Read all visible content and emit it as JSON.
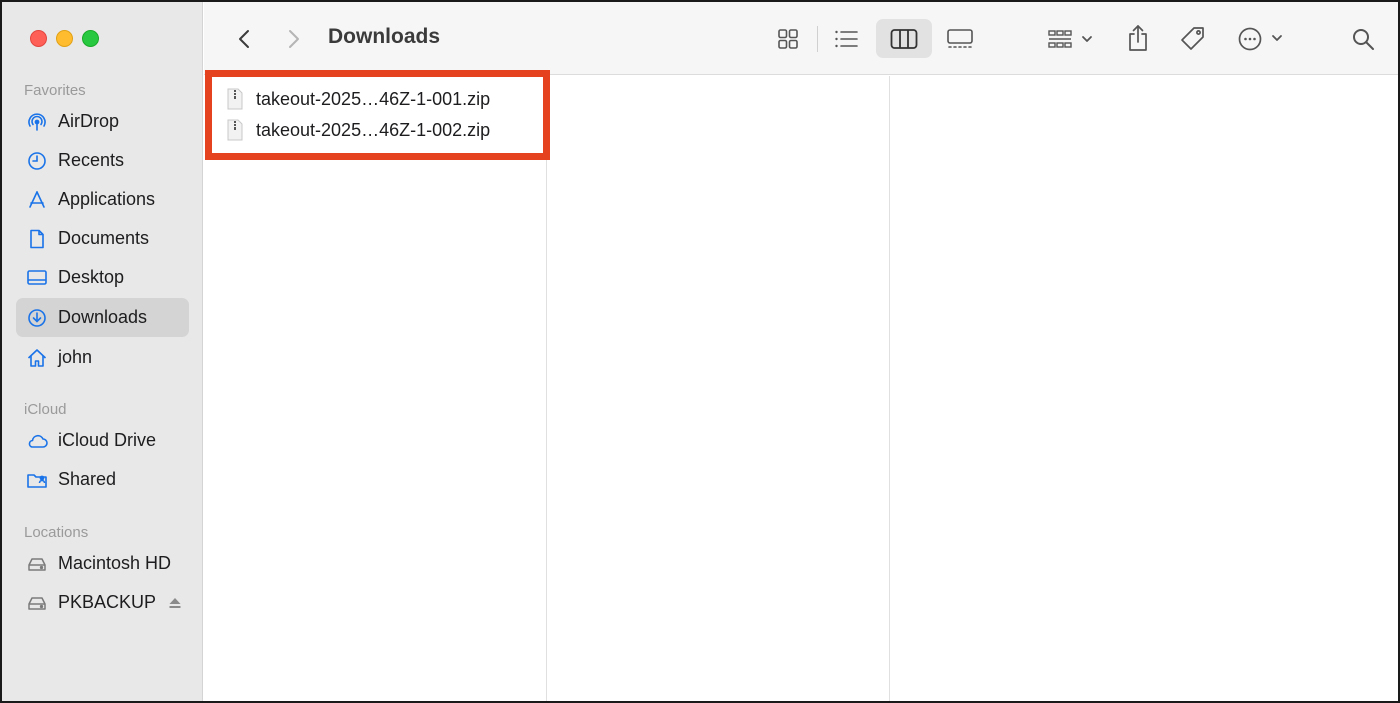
{
  "window": {
    "title": "Downloads"
  },
  "sidebar": {
    "sections": [
      {
        "label": "Favorites"
      },
      {
        "label": "iCloud"
      },
      {
        "label": "Locations"
      }
    ],
    "favorites": [
      {
        "label": "AirDrop",
        "icon": "airdrop-icon"
      },
      {
        "label": "Recents",
        "icon": "clock-icon"
      },
      {
        "label": "Applications",
        "icon": "applications-icon"
      },
      {
        "label": "Documents",
        "icon": "document-icon"
      },
      {
        "label": "Desktop",
        "icon": "desktop-icon"
      },
      {
        "label": "Downloads",
        "icon": "download-icon",
        "selected": true
      },
      {
        "label": "john",
        "icon": "home-icon"
      }
    ],
    "icloud": [
      {
        "label": "iCloud Drive",
        "icon": "cloud-icon"
      },
      {
        "label": "Shared",
        "icon": "shared-folder-icon"
      }
    ],
    "locations": [
      {
        "label": "Macintosh HD",
        "icon": "drive-icon"
      },
      {
        "label": "PKBACKUP",
        "icon": "drive-icon",
        "ejectable": true
      }
    ]
  },
  "toolbar": {
    "buttons": [
      "back-icon",
      "forward-icon",
      "icon-view-icon",
      "list-view-icon",
      "column-view-icon",
      "gallery-view-icon",
      "group-icon",
      "share-icon",
      "tag-icon",
      "more-icon",
      "search-icon"
    ],
    "active_view": "column"
  },
  "files": [
    {
      "name": "takeout-2025…46Z-1-001.zip"
    },
    {
      "name": "takeout-2025…46Z-1-002.zip"
    }
  ],
  "colors": {
    "accent": "#1a73e8",
    "highlight_border": "#e5431f",
    "sidebar_bg": "#e8e8e8",
    "selected_bg": "#d4d4d4"
  }
}
